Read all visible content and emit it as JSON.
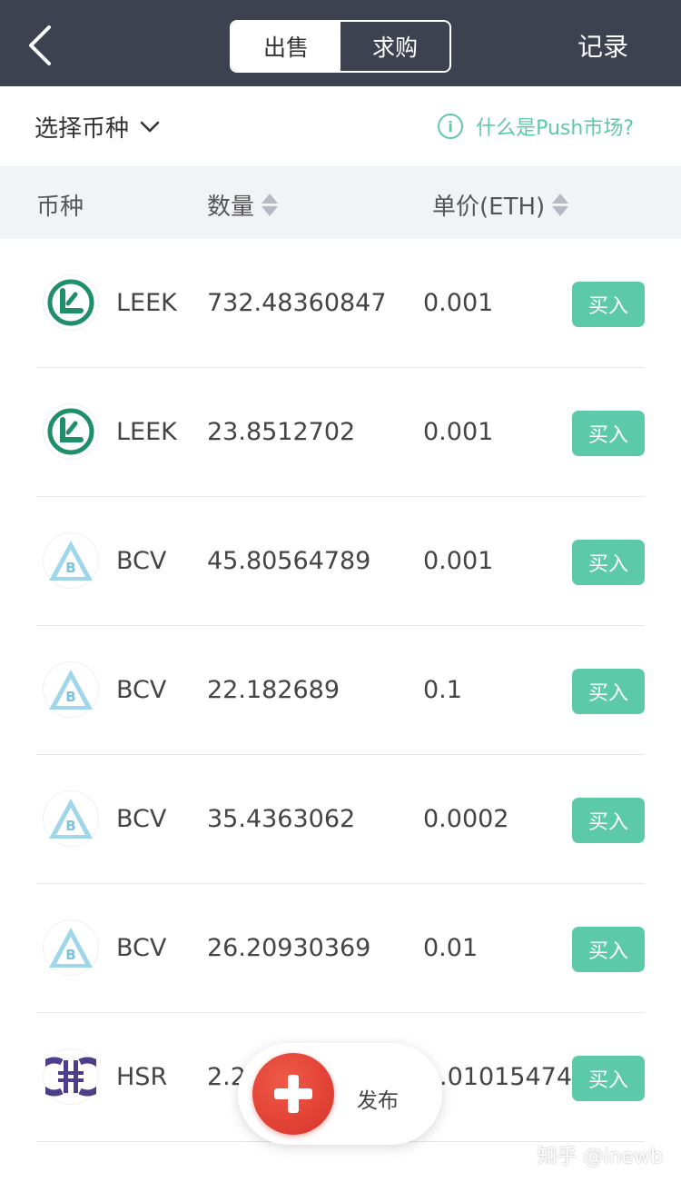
{
  "header": {
    "tabs": [
      {
        "label": "出售",
        "active": true
      },
      {
        "label": "求购",
        "active": false
      }
    ],
    "records_label": "记录"
  },
  "filter": {
    "select_label": "选择币种",
    "help_label": "什么是Push市场?"
  },
  "table": {
    "col_coin": "币种",
    "col_qty": "数量",
    "col_price": "单价(ETH)"
  },
  "rows": [
    {
      "coin": "LEEK",
      "icon": "leek-icon",
      "qty": "732.48360847",
      "price": "0.001",
      "action": "买入"
    },
    {
      "coin": "LEEK",
      "icon": "leek-icon",
      "qty": "23.8512702",
      "price": "0.001",
      "action": "买入"
    },
    {
      "coin": "BCV",
      "icon": "bcv-icon",
      "qty": "45.80564789",
      "price": "0.001",
      "action": "买入"
    },
    {
      "coin": "BCV",
      "icon": "bcv-icon",
      "qty": "22.182689",
      "price": "0.1",
      "action": "买入"
    },
    {
      "coin": "BCV",
      "icon": "bcv-icon",
      "qty": "35.4363062",
      "price": "0.0002",
      "action": "买入"
    },
    {
      "coin": "BCV",
      "icon": "bcv-icon",
      "qty": "26.20930369",
      "price": "0.01",
      "action": "买入"
    },
    {
      "coin": "HSR",
      "icon": "hsr-icon",
      "qty": "2.2",
      "price": ".01015474",
      "action": "买入"
    }
  ],
  "fab": {
    "label": "发布"
  },
  "watermark": "知乎 @inewb",
  "colors": {
    "header_bg": "#3d4150",
    "accent_green": "#5ccaa8",
    "fab_red": "#e0392d"
  }
}
